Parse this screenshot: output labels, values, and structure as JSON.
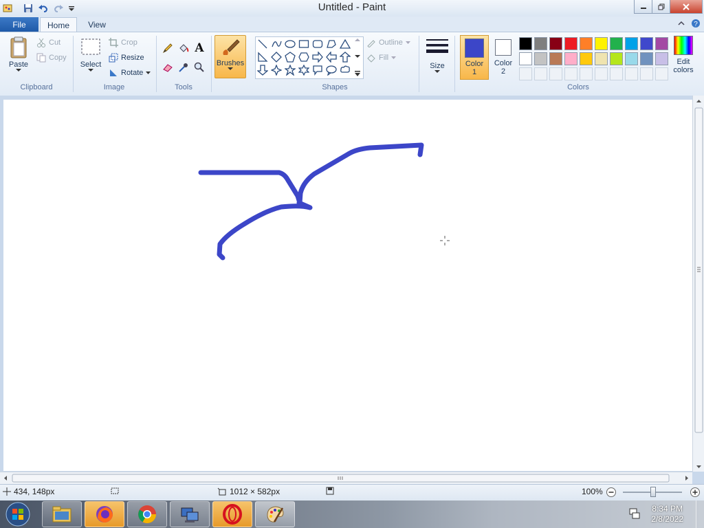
{
  "window": {
    "title": "Untitled - Paint"
  },
  "tabs": {
    "file": "File",
    "home": "Home",
    "view": "View"
  },
  "clipboard": {
    "paste": "Paste",
    "cut": "Cut",
    "copy": "Copy",
    "label": "Clipboard"
  },
  "image": {
    "select": "Select",
    "crop": "Crop",
    "resize": "Resize",
    "rotate": "Rotate",
    "label": "Image"
  },
  "tools": {
    "label": "Tools"
  },
  "brushes": {
    "label": "Brushes"
  },
  "shapes": {
    "outline": "Outline",
    "fill": "Fill",
    "label": "Shapes"
  },
  "size": {
    "label": "Size"
  },
  "colors": {
    "color1": "Color",
    "color1_num": "1",
    "color2": "Color",
    "color2_num": "2",
    "edit1": "Edit",
    "edit2": "colors",
    "label": "Colors",
    "color1_value": "#3c46c8",
    "color2_value": "#ffffff",
    "palette_row1": [
      "#000000",
      "#7f7f7f",
      "#880015",
      "#ed1c24",
      "#ff7f27",
      "#fff200",
      "#22b14c",
      "#00a2e8",
      "#3f48cc",
      "#a349a4"
    ],
    "palette_row2": [
      "#ffffff",
      "#c3c3c3",
      "#b97a57",
      "#ffaec9",
      "#ffc90e",
      "#efe4b0",
      "#b5e61d",
      "#99d9ea",
      "#7092be",
      "#c8bfe7"
    ]
  },
  "stroke_color": "#3c46c8",
  "status": {
    "position": "434, 148px",
    "canvas_size": "1012 × 582px",
    "zoom": "100%"
  },
  "taskbar": {
    "time": "8:34 PM",
    "date": "2/8/2022"
  }
}
